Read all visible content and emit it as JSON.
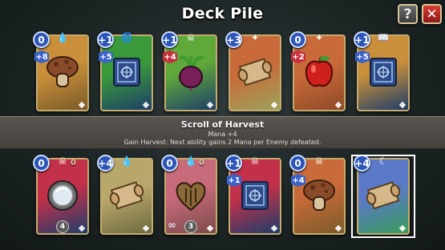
{
  "header": {
    "title": "Deck Pile",
    "help_label": "?",
    "close_label": "✕"
  },
  "tooltip": {
    "title": "Scroll of Harvest",
    "mana_line": "Mana +4",
    "description": "Gain Harvest: Next ability gains 2 Mana per Enemy defeated."
  },
  "colors": {
    "cost_blue": "#2d55b8",
    "mod_blue": "#3a62c9",
    "mod_red": "#c62f3d",
    "card_border": "#c6ab6e",
    "close_red": "#d63b32"
  },
  "cards_top": [
    {
      "name": "mushroom",
      "cost": "0",
      "mods": [
        "+8"
      ],
      "mod_colors": [
        "blue"
      ],
      "element_icon": "water-drop-icon",
      "bg": [
        "#c98f3a",
        "#7a5b28"
      ],
      "art": "mushroom-icon"
    },
    {
      "name": "spellbook",
      "cost": "+1",
      "mods": [
        "+5"
      ],
      "mod_colors": [
        "blue"
      ],
      "element_icon": "wind-icon",
      "bg": [
        "#3a9a3a",
        "#1d3e6a"
      ],
      "art": "spellbook-icon"
    },
    {
      "name": "beet",
      "cost": "+1",
      "mods": [
        "+4"
      ],
      "mod_colors": [
        "red"
      ],
      "element_icon": "bones-icon",
      "bg": [
        "#5fa83a",
        "#1d3e6a"
      ],
      "art": "beet-icon"
    },
    {
      "name": "scroll",
      "cost": "+3",
      "mods": [],
      "mod_colors": [],
      "element_icon": "claw-icon",
      "bg": [
        "#c96a3a",
        "#9aa35a"
      ],
      "art": "scroll-icon"
    },
    {
      "name": "apple",
      "cost": "0",
      "mods": [
        "+2"
      ],
      "mod_colors": [
        "red"
      ],
      "element_icon": "claw-icon",
      "bg": [
        "#c96a3a",
        "#8f4a26"
      ],
      "art": "apple-icon"
    },
    {
      "name": "spellbook-2",
      "cost": "+1",
      "mods": [
        "+5"
      ],
      "mod_colors": [
        "blue"
      ],
      "element_icon": "book-icon",
      "bg": [
        "#c98f3a",
        "#1d3e6a"
      ],
      "art": "spellbook-icon"
    }
  ],
  "cards_bottom": [
    {
      "name": "mirror",
      "cost": "0",
      "mods": [],
      "mod_colors": [],
      "element_icon": "skull-icon",
      "element_num": "0",
      "bg": [
        "#c2304a",
        "#1d3e6a"
      ],
      "art": "mirror-icon",
      "bottom_num": "4"
    },
    {
      "name": "scroll-2",
      "cost": "+4",
      "mods": [],
      "mod_colors": [],
      "element_icon": "water-drop-icon",
      "bg": [
        "#b8a76a",
        "#6c6a40"
      ],
      "art": "scroll-icon"
    },
    {
      "name": "heart-shield",
      "cost": "0",
      "mods": [],
      "mod_colors": [],
      "element_icon": "water-drop-icon",
      "element_num": "0",
      "bg": [
        "#c76a7a",
        "#7a4a4a"
      ],
      "art": "heart-icon",
      "infinity": "∞",
      "bottom_num": "3"
    },
    {
      "name": "spellbook-3",
      "cost": "+1",
      "mods": [
        "+1"
      ],
      "mod_colors": [
        "blue"
      ],
      "element_icon": "skull-icon",
      "bg": [
        "#c2304a",
        "#1d3e6a"
      ],
      "art": "spellbook-icon"
    },
    {
      "name": "mushroom-2",
      "cost": "0",
      "mods": [
        "+4"
      ],
      "mod_colors": [
        "blue"
      ],
      "element_icon": "skull-icon",
      "bg": [
        "#c96a3a",
        "#7a5b28"
      ],
      "art": "mushroom-icon"
    },
    {
      "name": "scroll-of-harvest",
      "cost": "+4",
      "mods": [],
      "mod_colors": [],
      "element_icon": "moon-icon",
      "bg": [
        "#5a7ac9",
        "#3a9a5a"
      ],
      "art": "scroll-icon",
      "selected": true
    }
  ]
}
